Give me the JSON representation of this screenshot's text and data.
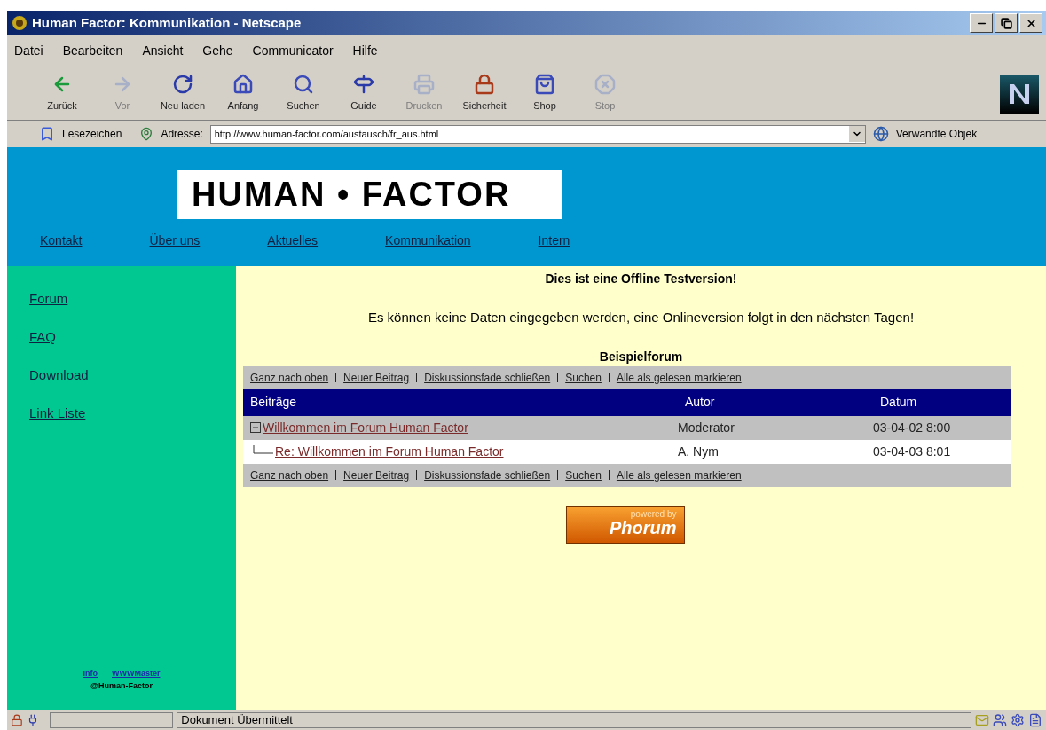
{
  "window": {
    "title": "Human Factor: Kommunikation - Netscape"
  },
  "menu": [
    "Datei",
    "Bearbeiten",
    "Ansicht",
    "Gehe",
    "Communicator",
    "Hilfe"
  ],
  "toolbar": [
    {
      "label": "Zurück",
      "disabled": false
    },
    {
      "label": "Vor",
      "disabled": true
    },
    {
      "label": "Neu laden",
      "disabled": false
    },
    {
      "label": "Anfang",
      "disabled": false
    },
    {
      "label": "Suchen",
      "disabled": false
    },
    {
      "label": "Guide",
      "disabled": false
    },
    {
      "label": "Drucken",
      "disabled": true
    },
    {
      "label": "Sicherheit",
      "disabled": false
    },
    {
      "label": "Shop",
      "disabled": false
    },
    {
      "label": "Stop",
      "disabled": true
    }
  ],
  "location_bar": {
    "bookmarks": "Lesezeichen",
    "address_label": "Adresse:",
    "url": "http://www.human-factor.com/austausch/fr_aus.html",
    "related": "Verwandte Objek"
  },
  "page": {
    "logo": "HUMAN • FACTOR",
    "nav": [
      "Kontakt",
      "Über uns",
      "Aktuelles",
      "Kommunikation",
      "Intern"
    ],
    "sidebar": {
      "links": [
        "Forum",
        "FAQ",
        "Download",
        "Link Liste"
      ],
      "footer_links": [
        "Info",
        "WWWMaster"
      ],
      "footer_text": "@Human-Factor"
    },
    "notice": "Dies ist eine Offline Testversion!",
    "message": "Es können keine Daten eingegeben werden, eine Onlineversion folgt in den nächsten Tagen!",
    "forum": {
      "title": "Beispielforum",
      "nav_top": [
        "Ganz nach oben",
        "Neuer Beitrag",
        "Diskussionsfade schließen",
        "Suchen",
        "Alle als gelesen markieren"
      ],
      "columns": [
        "Beiträge",
        "Autor",
        "Datum"
      ],
      "rows": [
        {
          "title": "Willkommen im Forum Human Factor",
          "author": "Moderator",
          "date": "03-04-02 8:00",
          "expanded": true,
          "children": [
            {
              "title": "Re: Willkommen im Forum Human Factor",
              "author": "A. Nym",
              "date": "03-04-03 8:01"
            }
          ]
        }
      ],
      "nav_bottom": [
        "Ganz nach oben",
        "Neuer Beitrag",
        "Diskussionsfade schließen",
        "Suchen",
        "Alle als gelesen markieren"
      ]
    },
    "badge": {
      "top": "powered by",
      "main": "Phorum"
    }
  },
  "status_bar": {
    "text": "Dokument Übermittelt"
  }
}
